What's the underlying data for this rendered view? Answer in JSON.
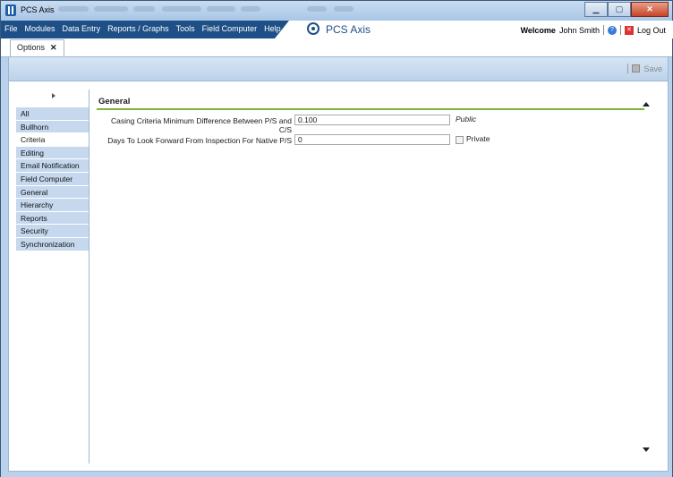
{
  "window": {
    "title": "PCS Axis",
    "controls": {
      "minimize": "▁",
      "maximize": "▢",
      "close": "✕"
    }
  },
  "menubar": {
    "items": [
      "File",
      "Modules",
      "Data Entry",
      "Reports / Graphs",
      "Tools",
      "Field Computer",
      "Help"
    ],
    "brand": "PCS Axis",
    "welcome_label": "Welcome",
    "user_name": "John Smith",
    "help_icon": "?",
    "logout_label": "Log Out",
    "logout_icon": "✕"
  },
  "tabs": [
    {
      "label": "Options",
      "close": "✕"
    }
  ],
  "toolbar": {
    "save_label": "Save"
  },
  "sidebar": {
    "items": [
      "All",
      "Bullhorn",
      "Criteria",
      "Editing",
      "Email Notification",
      "Field Computer",
      "General",
      "Hierarchy",
      "Reports",
      "Security",
      "Synchronization"
    ],
    "active": "Criteria"
  },
  "section": {
    "title": "General",
    "fields": [
      {
        "label": "Casing Criteria Minimum Difference Between P/S and C/S",
        "value": "0.100",
        "scope": "Public"
      },
      {
        "label": "Days To Look Forward From Inspection For Native P/S",
        "value": "0",
        "scope": "Private",
        "checked": false
      }
    ]
  },
  "colors": {
    "menubar": "#1e4f86",
    "section_line": "#7bb53c",
    "sidebar_item": "#c5d8ee"
  }
}
